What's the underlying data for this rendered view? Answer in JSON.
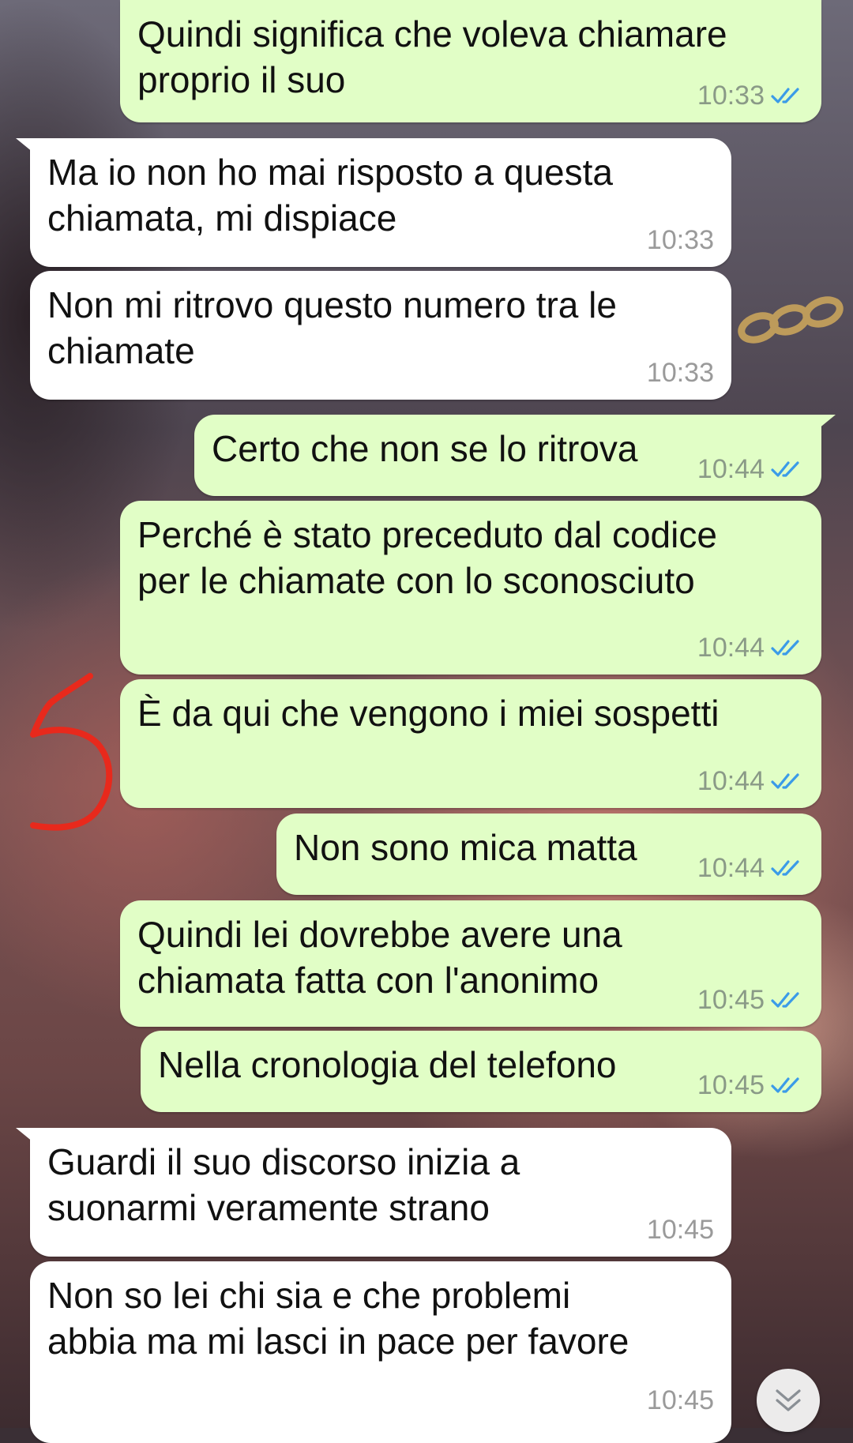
{
  "colors": {
    "outgoing_bubble": "#e1fec6",
    "incoming_bubble": "#ffffff",
    "read_ticks": "#3b9be8",
    "annotation": "#e8291c"
  },
  "messages": [
    {
      "direction": "outgoing",
      "lines": [
        "Quindi significa che voleva chiamare",
        "proprio il suo"
      ],
      "time": "10:33",
      "status": "read"
    },
    {
      "direction": "incoming",
      "lines": [
        "Ma io non ho mai risposto a questa",
        "chiamata, mi dispiace"
      ],
      "time": "10:33"
    },
    {
      "direction": "incoming",
      "lines": [
        "Non mi ritrovo questo numero tra le",
        "chiamate"
      ],
      "time": "10:33"
    },
    {
      "direction": "outgoing",
      "lines": [
        "Certo che non se lo ritrova"
      ],
      "time": "10:44",
      "status": "read"
    },
    {
      "direction": "outgoing",
      "lines": [
        "Perché è stato preceduto dal codice",
        "per le chiamate con lo sconosciuto"
      ],
      "time": "10:44",
      "status": "read"
    },
    {
      "direction": "outgoing",
      "lines": [
        "È da qui che vengono i miei sospetti"
      ],
      "time": "10:44",
      "status": "read"
    },
    {
      "direction": "outgoing",
      "lines": [
        "Non sono mica matta"
      ],
      "time": "10:44",
      "status": "read"
    },
    {
      "direction": "outgoing",
      "lines": [
        "Quindi lei dovrebbe avere una",
        "chiamata fatta con l'anonimo"
      ],
      "time": "10:45",
      "status": "read"
    },
    {
      "direction": "outgoing",
      "lines": [
        "Nella cronologia del telefono"
      ],
      "time": "10:45",
      "status": "read"
    },
    {
      "direction": "incoming",
      "lines": [
        "Guardi il suo discorso inizia a",
        "suonarmi veramente strano"
      ],
      "time": "10:45"
    },
    {
      "direction": "incoming",
      "lines": [
        "Non so lei chi sia e che problemi",
        "abbia ma mi lasci in pace per favore"
      ],
      "time": "10:45"
    }
  ],
  "annotation": {
    "icon": "hand-drawn-5-annotation"
  },
  "scroll_button": {
    "icon": "double-chevron-down-icon"
  }
}
